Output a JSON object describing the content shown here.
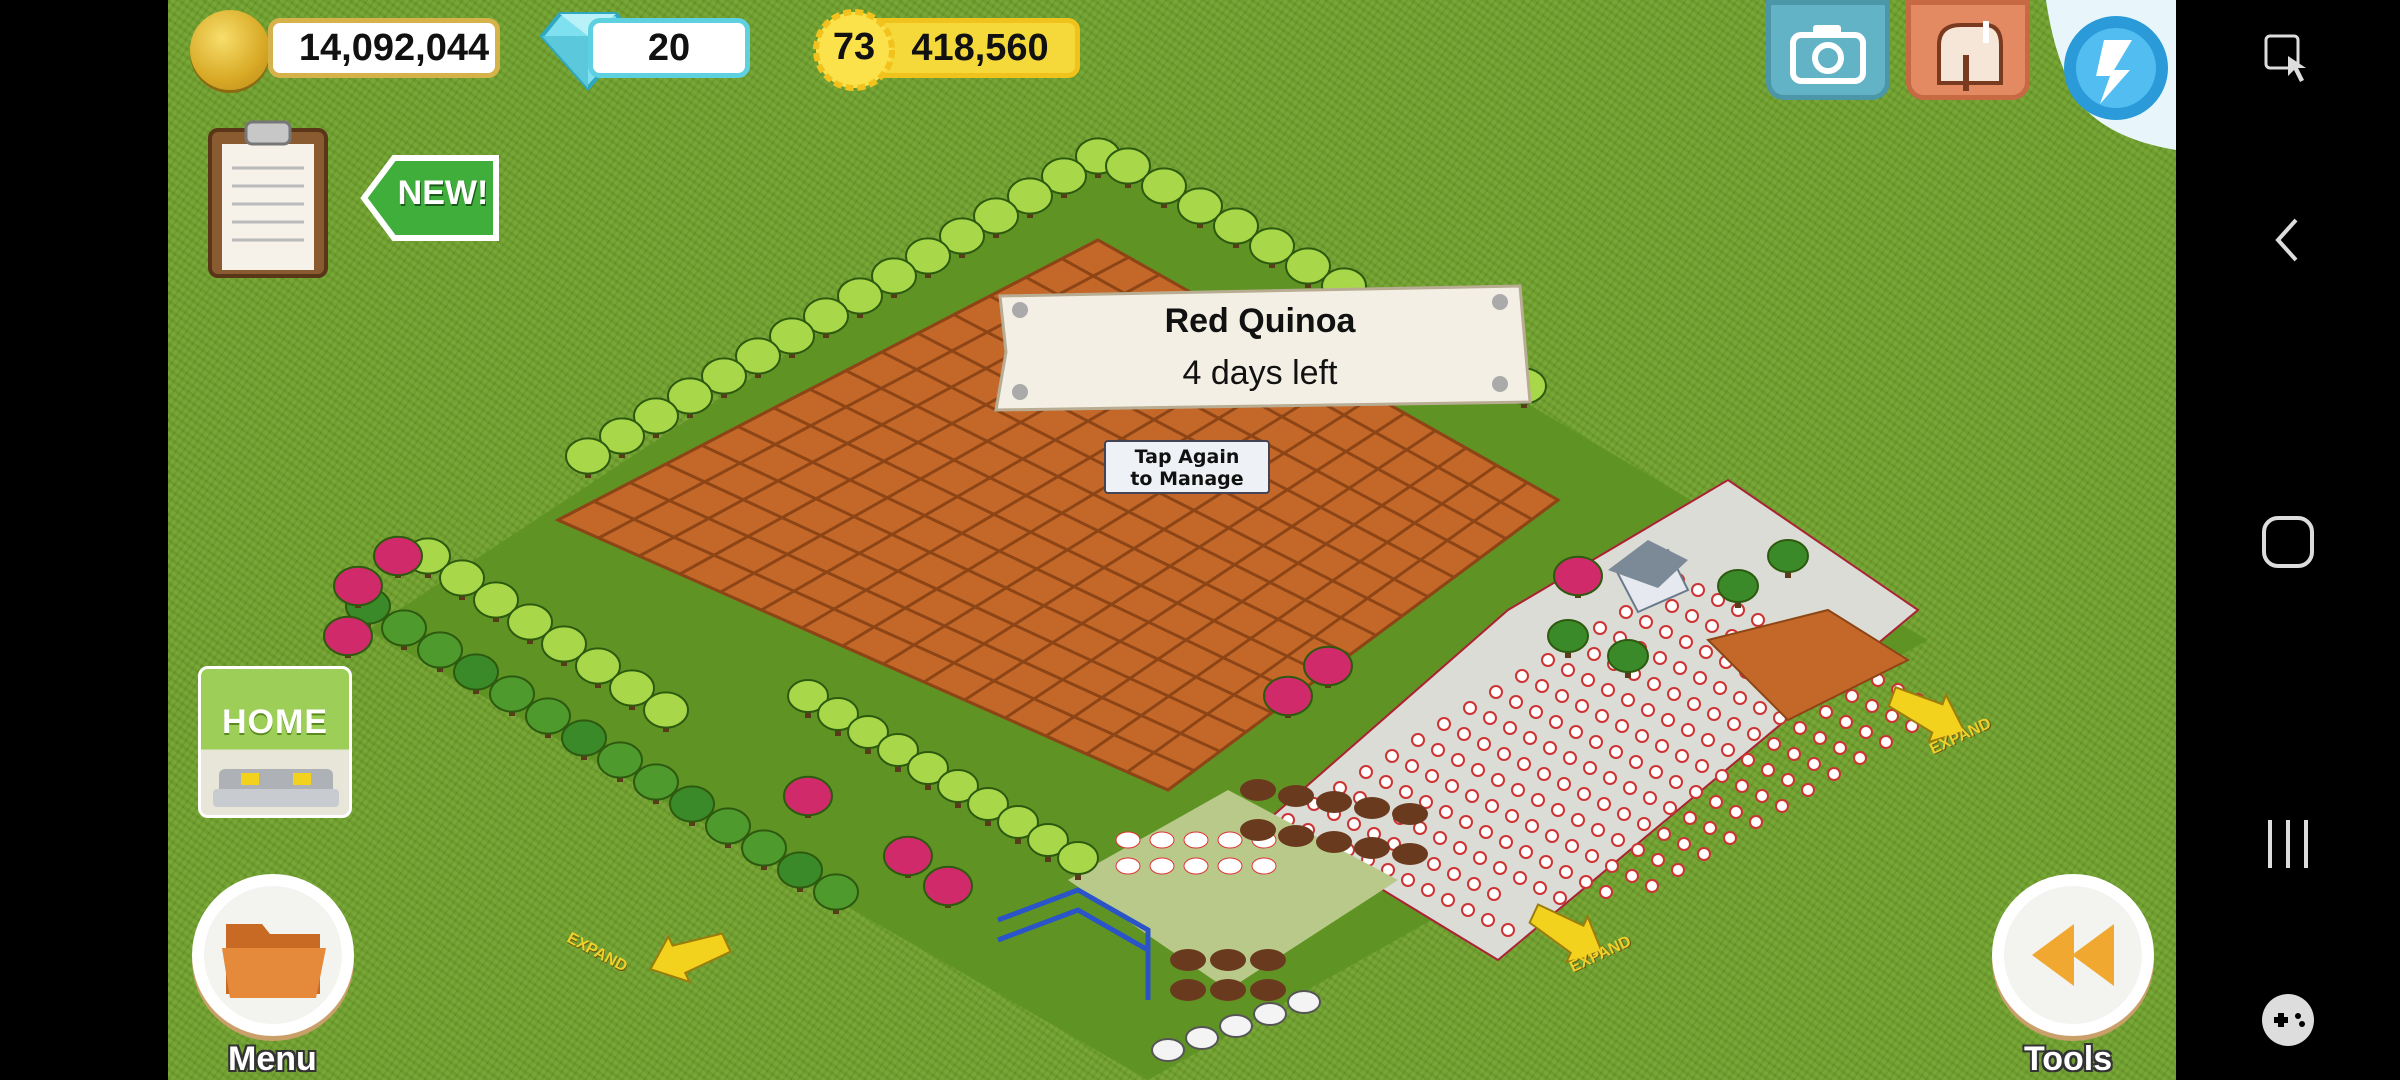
{
  "hud": {
    "coins": "14,092,044",
    "gems": "20",
    "level": "73",
    "xp": "418,560",
    "new_badge": "NEW!"
  },
  "tooltip": {
    "crop_name": "Red Quinoa",
    "time_left": "4 days left"
  },
  "tap_hint": {
    "line1": "Tap Again",
    "line2": "to Manage"
  },
  "home_card": {
    "label": "HOME"
  },
  "buttons": {
    "menu_label": "Menu",
    "tools_label": "Tools"
  },
  "expand_label": "EXPAND",
  "icons": [
    "coin-icon",
    "gem-icon",
    "level-star-icon",
    "camera-icon",
    "mailbox-icon",
    "level-up-icon",
    "clipboard-icon",
    "folder-icon",
    "rewind-icon",
    "expand-arrow-icon",
    "back-icon",
    "home-icon",
    "recents-icon",
    "game-tools-icon",
    "accessibility-icon"
  ],
  "colors": {
    "grass": "#6ea02a",
    "soil": "#c86a2a",
    "hud_gold": "#f5d93a",
    "hud_cyan": "#5ed1e0",
    "button_orange": "#f0a830"
  }
}
